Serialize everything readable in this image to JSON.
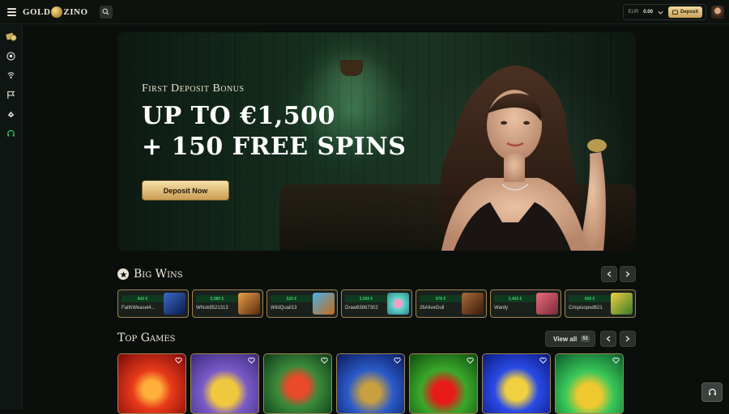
{
  "header": {
    "logo_left": "GOLD",
    "logo_right": "ZINO",
    "currency": "EUR",
    "balance": "0.00",
    "deposit_label": "Deposit"
  },
  "sidebar": {
    "icons": [
      "casino-chips-icon",
      "soccer-ball-icon",
      "live-casino-icon",
      "flag-icon",
      "promotions-icon",
      "support-headset-icon"
    ]
  },
  "hero": {
    "kicker": "First Deposit Bonus",
    "line1": "UP TO €1,500",
    "line2": "+ 150 FREE SPINS",
    "button_label": "Deposit Now"
  },
  "big_wins": {
    "title": "Big Wins",
    "items": [
      {
        "amount": "643 €",
        "user": "FaithWeasel4...",
        "color": "#2b4a8a"
      },
      {
        "amount": "5,980 €",
        "user": "Whisk9521313",
        "color": "#c86a2a"
      },
      {
        "amount": "520 €",
        "user": "WildQuail13",
        "color": "#3a8ac8"
      },
      {
        "amount": "3,050 €",
        "user": "Draw83867302",
        "color": "#6ad0c8"
      },
      {
        "amount": "578 €",
        "user": "26AliveGull",
        "color": "#7a4a2a"
      },
      {
        "amount": "3,402 €",
        "user": "Wardy",
        "color": "#c84a5a"
      },
      {
        "amount": "609 €",
        "user": "Crispisopod621",
        "color": "#e8c43a"
      }
    ]
  },
  "top_games": {
    "title": "Top Games",
    "view_all": "View all",
    "count": "51",
    "games": [
      {
        "name": "jester-game",
        "bg1": "#e83a1a",
        "bg2": "#7a0a0a"
      },
      {
        "name": "golden-orb-game",
        "bg1": "#7a5ac8",
        "bg2": "#3a2a7a"
      },
      {
        "name": "joker-card-game",
        "bg1": "#3a8a3a",
        "bg2": "#0f3a1a"
      },
      {
        "name": "train-game",
        "bg1": "#2a5ac8",
        "bg2": "#0a1a5a"
      },
      {
        "name": "cherries-game",
        "bg1": "#3aa82a",
        "bg2": "#0f4a0f"
      },
      {
        "name": "lightning-game",
        "bg1": "#2a4ae8",
        "bg2": "#0a1a7a"
      },
      {
        "name": "pots-of-gold-game",
        "bg1": "#3ac85a",
        "bg2": "#0a5a2a"
      }
    ]
  }
}
